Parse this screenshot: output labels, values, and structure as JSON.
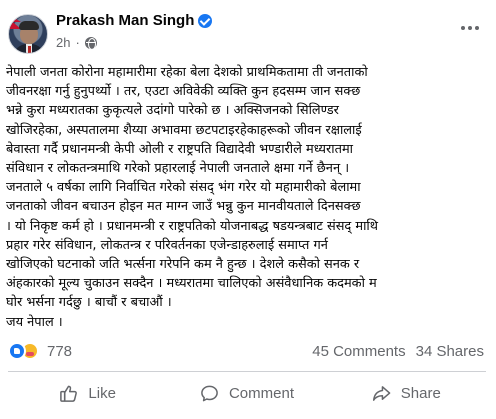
{
  "post": {
    "author": "Prakash Man Singh",
    "verified": true,
    "time": "2h",
    "audience_icon": "globe-icon",
    "body": "नेपाली जनता कोरोना महामारीमा रहेका बेला देशको प्राथमिकतामा ती जनताको\nजीवनरक्षा गर्नु हुनुपर्थ्यो । तर, एउटा अविवेकी व्यक्ति कुन हदसम्म जान सक्छ\nभन्ने कुरा मध्यरातका कुकृत्यले उदांगो पारेको छ । अक्सिजनको सिलिण्डर\nखोजिरहेका, अस्पतालमा शैय्या अभावमा छटपटाइरहेकाहरूको जीवन रक्षालाई\nबेवास्ता गर्दै प्रधानमन्त्री केपी ओली र राष्ट्रपति विद्यादेवी भण्डारीले मध्यरातमा\nसंविधान र लोकतन्त्रमाथि गरेको प्रहारलाई नेपाली जनताले क्षमा गर्ने छैनन् ।\nजनताले ५ वर्षका लागि निर्वाचित गरेको संसद् भंग गरेर यो महामारीको बेलामा\nजनताको जीवन बचाउन होइन मत माग्न जाउँ भन्नु कुन मानवीयताले दिनसक्छ\n। यो निकृष्ट कर्म हो । प्रधानमन्त्री र राष्ट्रपतिको योजनाबद्ध षडयन्त्रबाट संसद् माथि\nप्रहार  गरेर संविधान, लोकतन्त्र र परिवर्तनका एजेन्डाहरुलाई समाप्त गर्न\nखोजिएको घटनाको जति भर्त्सना गरेपनि कम नै हुन्छ । देशले कसैको सनक र\nअंहकारको मूल्य चुकाउन सक्दैन । मध्यरातमा चालिएको असंवैधानिक कदमको म\nघोर भर्सना गर्दछु । बाचौं र बचाऔं ।\nजय नेपाल ।"
  },
  "stats": {
    "reaction_icons": [
      "like-icon",
      "care-icon"
    ],
    "reactions": "778",
    "comments": "45 Comments",
    "shares": "34 Shares"
  },
  "actions": {
    "like": "Like",
    "comment": "Comment",
    "share": "Share"
  },
  "colors": {
    "accent": "#1877f2",
    "secondary_text": "#65676b",
    "divider": "#ced0d4"
  }
}
